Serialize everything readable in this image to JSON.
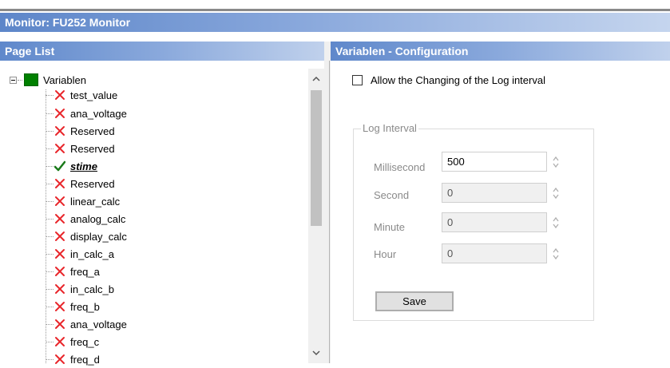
{
  "window": {
    "title": "Monitor: FU252 Monitor"
  },
  "page_list": {
    "header": "Page List",
    "root": {
      "label": "Variablen",
      "expanded": true,
      "icon": "green-square-icon",
      "color": "#008000"
    },
    "items": [
      {
        "label": "test_value",
        "status": "error"
      },
      {
        "label": "ana_voltage",
        "status": "error"
      },
      {
        "label": "Reserved",
        "status": "error"
      },
      {
        "label": "Reserved",
        "status": "error"
      },
      {
        "label": "stime",
        "status": "ok",
        "selected": true
      },
      {
        "label": "Reserved",
        "status": "error"
      },
      {
        "label": "linear_calc",
        "status": "error"
      },
      {
        "label": "analog_calc",
        "status": "error"
      },
      {
        "label": "display_calc",
        "status": "error"
      },
      {
        "label": "in_calc_a",
        "status": "error"
      },
      {
        "label": "freq_a",
        "status": "error"
      },
      {
        "label": "in_calc_b",
        "status": "error"
      },
      {
        "label": "freq_b",
        "status": "error"
      },
      {
        "label": "ana_voltage",
        "status": "error"
      },
      {
        "label": "freq_c",
        "status": "error"
      },
      {
        "label": "freq_d",
        "status": "error"
      }
    ]
  },
  "config": {
    "header": "Variablen - Configuration",
    "allow_change": {
      "label": "Allow the Changing of the Log interval",
      "checked": false
    },
    "log_interval": {
      "legend": "Log Interval",
      "fields": [
        {
          "label": "Millisecond",
          "value": "500",
          "enabled": true
        },
        {
          "label": "Second",
          "value": "0",
          "enabled": false
        },
        {
          "label": "Minute",
          "value": "0",
          "enabled": false
        },
        {
          "label": "Hour",
          "value": "0",
          "enabled": false
        }
      ]
    },
    "save_label": "Save"
  },
  "colors": {
    "header_blue": "#5d86c9",
    "error_red": "#e8262b",
    "ok_green": "#1a7a1a",
    "tree_root_green": "#008000"
  }
}
